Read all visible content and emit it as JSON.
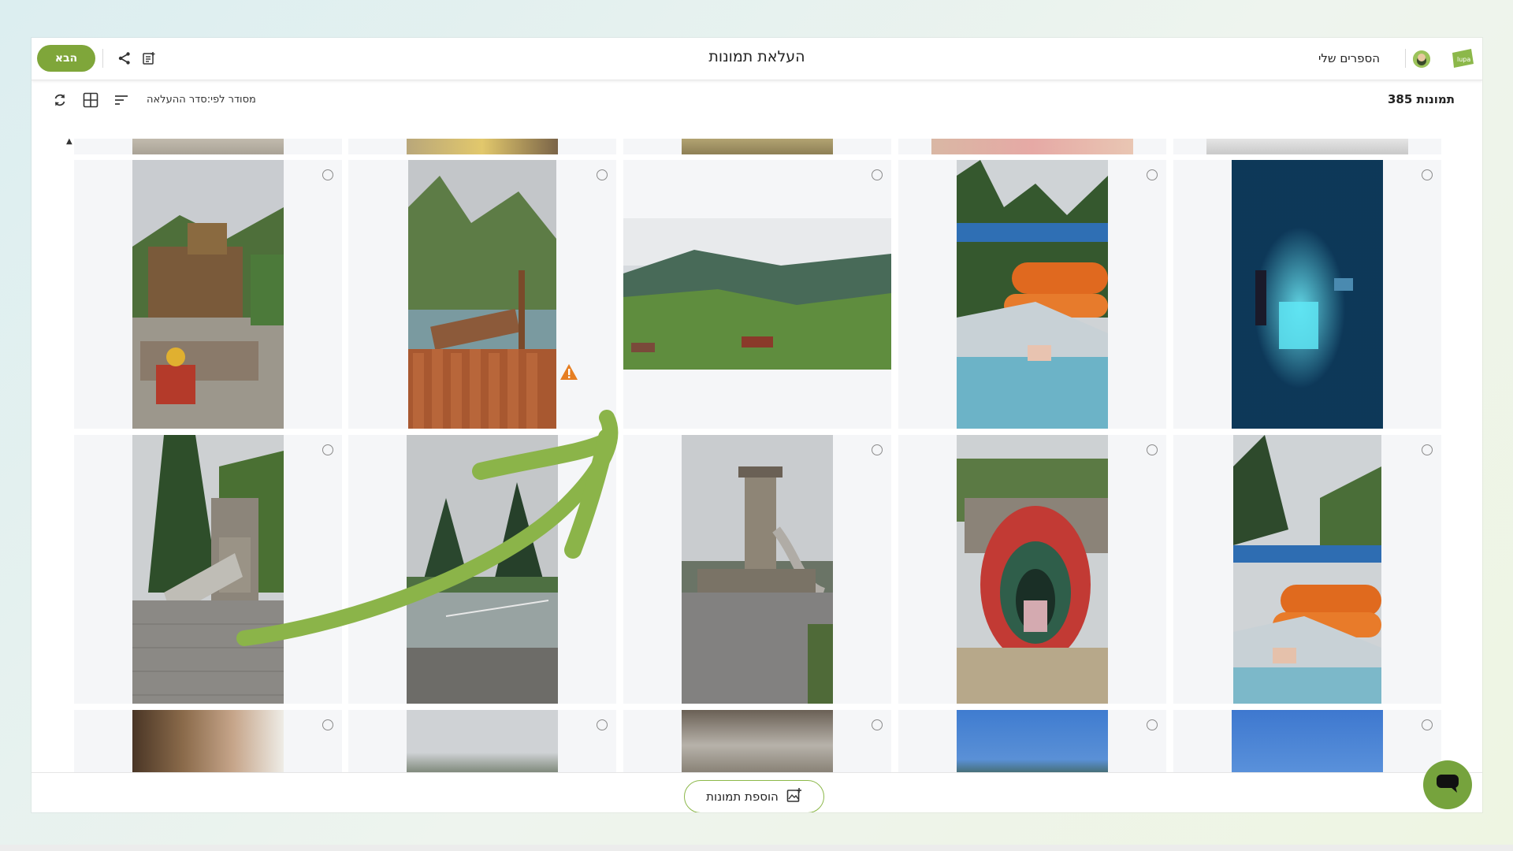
{
  "header": {
    "next_label": "הבא",
    "title": "העלאת תמונות",
    "my_books_label": "הספרים שלי",
    "logo_text": "lupa"
  },
  "toolbar": {
    "photo_count": "385 תמונות",
    "sorted_label": "מסודר לפי:סדר ההעלאה"
  },
  "footer": {
    "add_photos_label": "הוספת תמונות"
  },
  "colors": {
    "brand_green": "#7fa63a",
    "warning_orange": "#e67e22",
    "arrow_green": "#8bb449"
  },
  "icons": [
    "share-icon",
    "edit-notes-icon",
    "sort-icon",
    "grid-view-icon",
    "refresh-icon",
    "warning-icon",
    "add-photo-icon",
    "chat-icon"
  ]
}
